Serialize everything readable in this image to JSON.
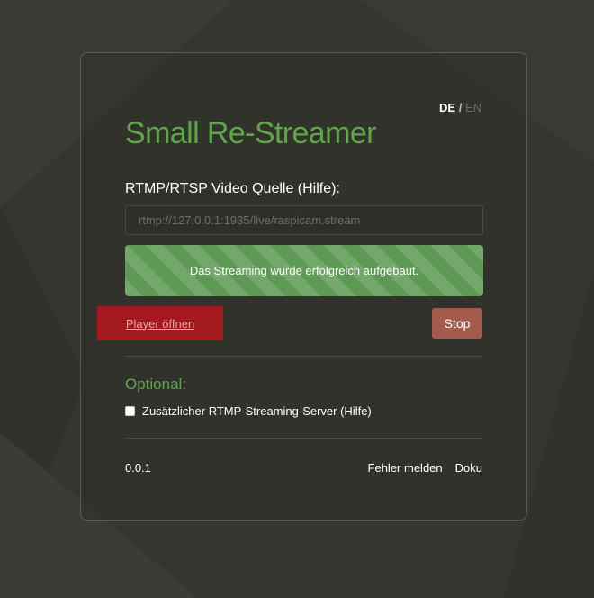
{
  "lang": {
    "de": "DE",
    "separator": "/",
    "en": "EN"
  },
  "app_title": "Small Re-Streamer",
  "source": {
    "label": "RTMP/RTSP Video Quelle (Hilfe):",
    "placeholder": "rtmp://127.0.0.1:1935/live/raspicam.stream"
  },
  "status_message": "Das Streaming wurde erfolgreich aufgebaut.",
  "buttons": {
    "player": "Player öffnen",
    "stop": "Stop"
  },
  "optional": {
    "heading": "Optional:",
    "checkbox_label": "Zusätzlicher RTMP-Streaming-Server (Hilfe)",
    "checked": false
  },
  "footer": {
    "version": "0.0.1",
    "report_link": "Fehler melden",
    "docs_link": "Doku"
  },
  "colors": {
    "accent_green": "#5fa64b",
    "success_bg": "#5e9a55",
    "player_bg": "#a3191d",
    "stop_bg": "#a55a4e",
    "page_bg": "#363530"
  }
}
